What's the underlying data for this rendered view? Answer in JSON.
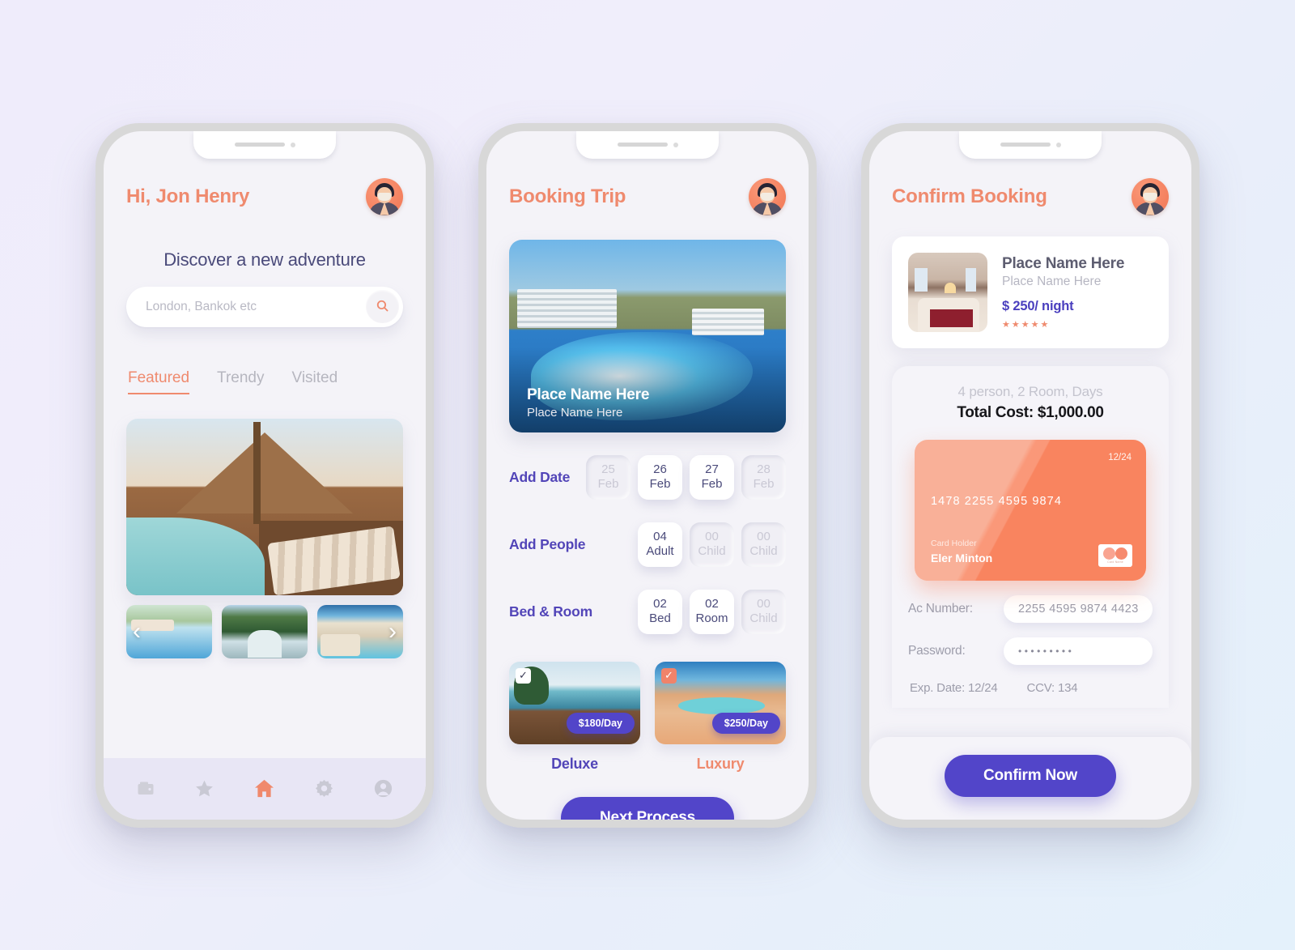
{
  "theme": {
    "coral": "#ef8a6e",
    "purple": "#5245c9",
    "indigo_text": "#4a4a7a",
    "bg_gradient_from": "#efecfb",
    "bg_gradient_to": "#e4f1fb"
  },
  "phone1": {
    "greeting": "Hi, Jon Henry",
    "tagline": "Discover a new adventure",
    "search": {
      "placeholder": "London, Bankok etc",
      "value": "",
      "icon": "search-icon"
    },
    "tabs": [
      {
        "label": "Featured",
        "active": true
      },
      {
        "label": "Trendy",
        "active": false
      },
      {
        "label": "Visited",
        "active": false
      }
    ],
    "hero": {
      "alt": "tropical resort with pool and loungers"
    },
    "thumbnails": [
      {
        "alt": "resort pool with palm trees"
      },
      {
        "alt": "forest river"
      },
      {
        "alt": "beach resort with huts"
      }
    ],
    "carousel": {
      "prev": "‹",
      "next": "›"
    },
    "nav": [
      {
        "name": "wallet-icon",
        "active": false
      },
      {
        "name": "star-icon",
        "active": false
      },
      {
        "name": "home-icon",
        "active": true
      },
      {
        "name": "gear-icon",
        "active": false
      },
      {
        "name": "profile-icon",
        "active": false
      }
    ]
  },
  "phone2": {
    "title": "Booking Trip",
    "hero": {
      "title": "Place Name Here",
      "subtitle": "Place Name Here",
      "alt": "hillside hotel resort with large lagoon pool"
    },
    "rows": [
      {
        "label": "Add Date",
        "chips": [
          {
            "top": "25",
            "bottom": "Feb",
            "selected": false
          },
          {
            "top": "26",
            "bottom": "Feb",
            "selected": true
          },
          {
            "top": "27",
            "bottom": "Feb",
            "selected": true
          },
          {
            "top": "28",
            "bottom": "Feb",
            "selected": false
          }
        ]
      },
      {
        "label": "Add People",
        "chips": [
          {
            "top": "04",
            "bottom": "Adult",
            "selected": true
          },
          {
            "top": "00",
            "bottom": "Child",
            "selected": false
          },
          {
            "top": "00",
            "bottom": "Child",
            "selected": false
          }
        ]
      },
      {
        "label": "Bed & Room",
        "chips": [
          {
            "top": "02",
            "bottom": "Bed",
            "selected": true
          },
          {
            "top": "02",
            "bottom": "Room",
            "selected": true
          },
          {
            "top": "00",
            "bottom": "Child",
            "selected": false
          }
        ]
      }
    ],
    "rooms": [
      {
        "name": "Deluxe",
        "price": "$180/Day",
        "checked": true,
        "check_style": "white",
        "alt": "poolside loungers at sunset with umbrella"
      },
      {
        "name": "Luxury",
        "price": "$250/Day",
        "checked": true,
        "check_style": "coral",
        "alt": "resort pool with palm trees and orange loungers"
      }
    ],
    "next_button": "Next Process"
  },
  "phone3": {
    "title": "Confirm Booking",
    "place": {
      "name": "Place Name Here",
      "subtitle": "Place Name Here",
      "price": "$ 250/ night",
      "stars": "★★★★★",
      "alt": "luxury hotel bedroom with red bed runner"
    },
    "summary": {
      "details": "4 person, 2 Room, Days",
      "total": "Total Cost: $1,000.00"
    },
    "card": {
      "expiry": "12/24",
      "number": "1478 2255 4595 9874",
      "holder_label": "Card Holder",
      "holder_name": "Eler Minton",
      "brand_label": "Card Name"
    },
    "form": {
      "ac_label": "Ac Number:",
      "ac_value": "2255 4595 9874 4423",
      "pw_label": "Password:",
      "pw_value": "•••••••••",
      "exp": "Exp. Date: 12/24",
      "ccv": "CCV: 134"
    },
    "confirm_button": "Confirm Now"
  }
}
